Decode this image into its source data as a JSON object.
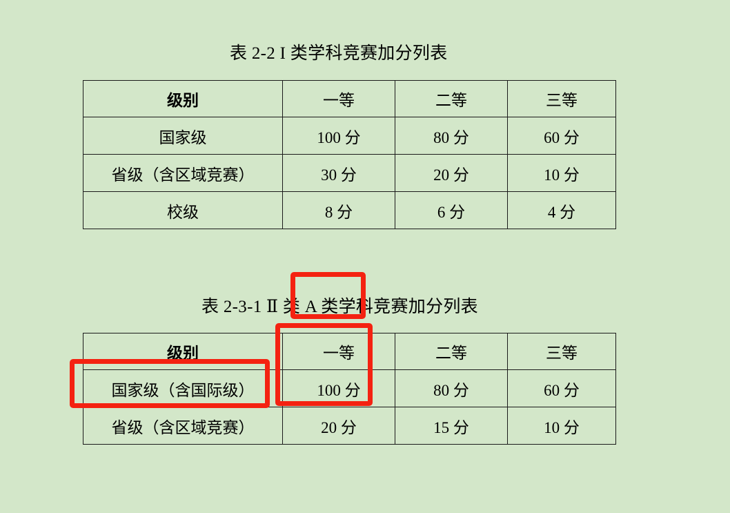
{
  "document": {
    "background_color": "#d3e7c9",
    "annotation_color": "#f42211"
  },
  "tables": [
    {
      "id": "table-2-2",
      "title": "表 2-2 I 类学科竞赛加分列表",
      "columns": [
        "级别",
        "一等",
        "二等",
        "三等"
      ],
      "rows": [
        {
          "level": "国家级",
          "first": "100 分",
          "second": "80 分",
          "third": "60 分"
        },
        {
          "level": "省级（含区域竞赛）",
          "first": "30 分",
          "second": "20 分",
          "third": "10 分"
        },
        {
          "level": "校级",
          "first": "8 分",
          "second": "6 分",
          "third": "4 分"
        }
      ]
    },
    {
      "id": "table-2-3-1",
      "title": "表 2-3-1 Ⅱ 类 A 类学科竞赛加分列表",
      "columns": [
        "级别",
        "一等",
        "二等",
        "三等"
      ],
      "rows": [
        {
          "level": "国家级（含国际级）",
          "first": "100 分",
          "second": "80 分",
          "third": "60 分"
        },
        {
          "level": "省级（含区域竞赛）",
          "first": "20 分",
          "second": "15 分",
          "third": "10 分"
        }
      ]
    }
  ],
  "annotations": [
    {
      "name": "title-highlight",
      "target": "类 A 类学"
    },
    {
      "name": "column-highlight",
      "target": "一等 / 100 分"
    },
    {
      "name": "row-highlight",
      "target": "国家级（含国际级）"
    }
  ]
}
